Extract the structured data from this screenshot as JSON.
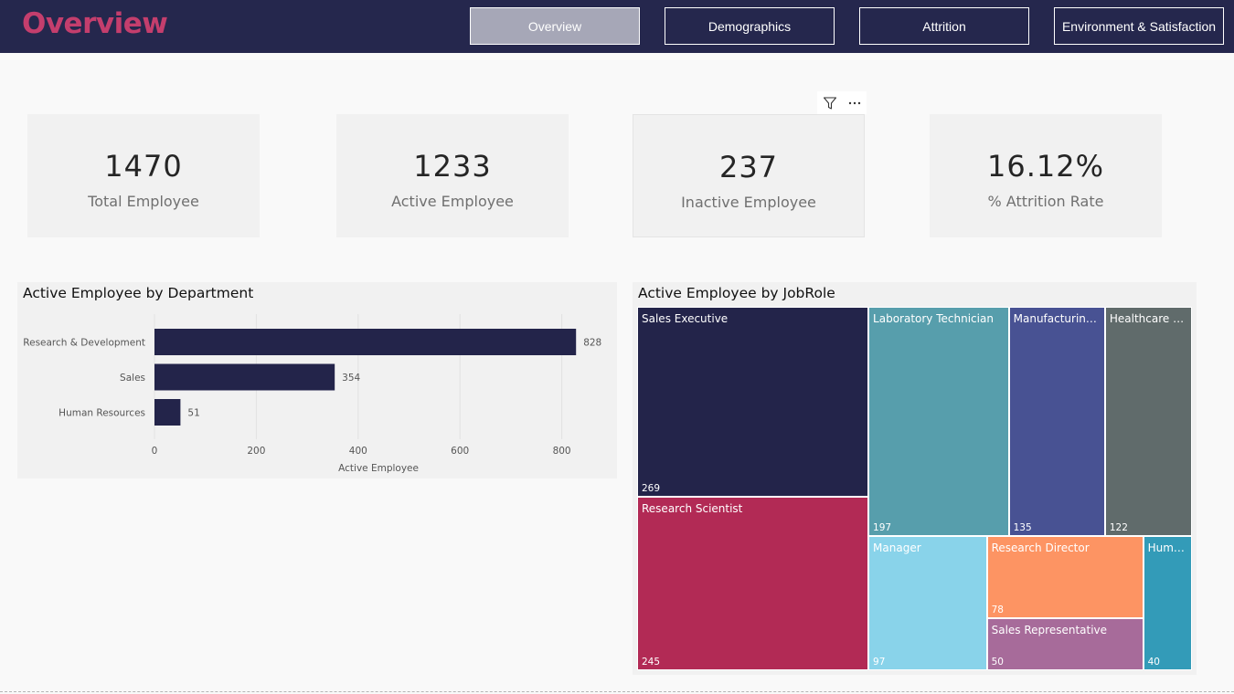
{
  "header": {
    "title": "Overview",
    "nav": [
      {
        "label": "Overview",
        "active": true
      },
      {
        "label": "Demographics",
        "active": false
      },
      {
        "label": "Attrition",
        "active": false
      },
      {
        "label": "Environment & Satisfaction",
        "active": false
      }
    ]
  },
  "colors": {
    "header_bg": "#25274d",
    "title": "#c43e6d",
    "bar": "#23244a"
  },
  "kpis": [
    {
      "value": "1470",
      "label": "Total Employee"
    },
    {
      "value": "1233",
      "label": "Active Employee"
    },
    {
      "value": "237",
      "label": "Inactive Employee"
    },
    {
      "value": "16.12%",
      "label": "% Attrition Rate"
    }
  ],
  "visual_tools": {
    "icons": [
      "filter-icon",
      "more-options-icon"
    ]
  },
  "charts": {
    "department": {
      "title": "Active Employee by Department"
    },
    "jobrole": {
      "title": "Active Employee by JobRole"
    }
  },
  "chart_data": [
    {
      "type": "bar",
      "orientation": "horizontal",
      "title": "Active Employee by Department",
      "categories": [
        "Research & Development",
        "Sales",
        "Human Resources"
      ],
      "values": [
        828,
        354,
        51
      ],
      "xlabel": "Active Employee",
      "ylabel": "",
      "xlim": [
        0,
        880
      ],
      "ticks": [
        0,
        200,
        400,
        600,
        800
      ],
      "grid": true,
      "color": "#23244a"
    },
    {
      "type": "treemap",
      "title": "Active Employee by JobRole",
      "items": [
        {
          "label": "Sales Executive",
          "value": 269,
          "color": "#23244a"
        },
        {
          "label": "Research Scientist",
          "value": 245,
          "color": "#b22a55"
        },
        {
          "label": "Laboratory Technician",
          "value": 197,
          "color": "#579eac"
        },
        {
          "label": "Manufacturing...",
          "value": 135,
          "color": "#485293"
        },
        {
          "label": "Healthcare R...",
          "value": 122,
          "color": "#606b6b"
        },
        {
          "label": "Manager",
          "value": 97,
          "color": "#89d3ea"
        },
        {
          "label": "Research Director",
          "value": 78,
          "color": "#fd9463"
        },
        {
          "label": "Sales Representative",
          "value": 50,
          "color": "#a76b9a"
        },
        {
          "label": "Huma...",
          "value": 40,
          "color": "#339bb8"
        }
      ]
    }
  ]
}
